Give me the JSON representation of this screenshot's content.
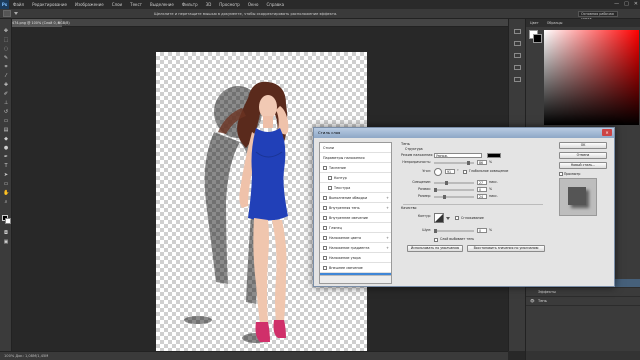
{
  "menubar": {
    "logo": "Ps",
    "items": [
      "Файл",
      "Редактирование",
      "Изображение",
      "Слои",
      "Текст",
      "Выделение",
      "Фильтр",
      "3D",
      "Просмотр",
      "Окно",
      "Справка"
    ],
    "win_min": "—",
    "win_max": "□",
    "win_close": "✕"
  },
  "optionsbar": {
    "hint": "Щелкните и перетащите мышью в документе, чтобы скорректировать расположение эффекта.",
    "workspace": "Основная рабочая среда"
  },
  "document": {
    "tab_label": "TN12474.png @ 100% (Слой 0, RGB/8)",
    "tab_close": "×"
  },
  "status": {
    "text": "100% Док: 1,08M/1,45M"
  },
  "picker": {
    "tabs": [
      "Цвет",
      "Образцы"
    ]
  },
  "layers": {
    "rows": [
      {
        "label": "Слой 0",
        "eye": "👁"
      },
      {
        "label": "Эффекты",
        "eye": ""
      },
      {
        "label": "Тень",
        "eye": "👁"
      }
    ]
  },
  "dialog": {
    "title": "Стиль слоя",
    "close": "✕",
    "styles": [
      {
        "label": "Стили",
        "checked": false,
        "plus": false
      },
      {
        "label": "Параметры наложения",
        "checked": false,
        "plus": false
      },
      {
        "label": "Тиснение",
        "checked": false,
        "plus": false
      },
      {
        "label": "Контур",
        "checked": false,
        "plus": false
      },
      {
        "label": "Текстура",
        "checked": false,
        "plus": false
      },
      {
        "label": "Выполнение обводки",
        "checked": false,
        "plus": true
      },
      {
        "label": "Внутренняя тень",
        "checked": false,
        "plus": true
      },
      {
        "label": "Внутреннее свечение",
        "checked": false,
        "plus": false
      },
      {
        "label": "Глянец",
        "checked": false,
        "plus": false
      },
      {
        "label": "Наложение цвета",
        "checked": false,
        "plus": true
      },
      {
        "label": "Наложение градиента",
        "checked": false,
        "plus": true
      },
      {
        "label": "Наложение узора",
        "checked": false,
        "plus": false
      },
      {
        "label": "Внешнее свечение",
        "checked": false,
        "plus": false
      },
      {
        "label": "Тень",
        "checked": true,
        "plus": true,
        "selected": true
      }
    ],
    "section_title": "Тень",
    "structure_title": "Структура",
    "blend_mode_label": "Режим наложения:",
    "blend_mode_value": "Умнож.",
    "opacity_label": "Непрозрачность:",
    "opacity_value": "86",
    "angle_label": "Угол:",
    "angle_value": "91",
    "global_light_label": "Глобальное освещение",
    "distance_label": "Смещение:",
    "distance_value": "27",
    "spread_label": "Размах:",
    "spread_value": "0",
    "size_label": "Размер:",
    "size_value": "24",
    "quality_title": "Качество",
    "contour_label": "Контур:",
    "antialias_label": "Сглаживание",
    "noise_label": "Шум:",
    "noise_value": "0",
    "knockout_label": "Слой выбивает тень",
    "btn_default": "Использовать по умолчанию",
    "btn_reset": "Восстановить значения по умолчанию",
    "unit_percent": "%",
    "unit_px": "пикс.",
    "unit_deg": "°",
    "btn_ok": "OK",
    "btn_cancel": "Отмена",
    "btn_new_style": "Новый стиль...",
    "preview_label": "Просмотр",
    "shadow_color": "#000000",
    "selection_color": "#3f86d6"
  }
}
